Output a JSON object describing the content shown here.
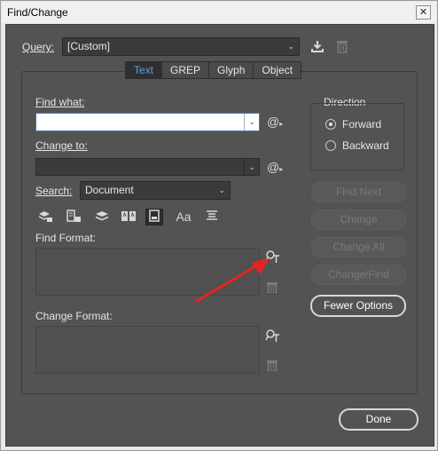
{
  "window": {
    "title": "Find/Change",
    "close_glyph": "✕"
  },
  "query": {
    "label": "Query:",
    "value": "[Custom]",
    "save_icon": "save-query-icon",
    "delete_icon": "delete-query-icon"
  },
  "tabs": [
    {
      "label": "Text",
      "active": true
    },
    {
      "label": "GREP",
      "active": false
    },
    {
      "label": "Glyph",
      "active": false
    },
    {
      "label": "Object",
      "active": false
    }
  ],
  "find": {
    "label": "Find what:",
    "value": "",
    "special_chars_glyph": "@"
  },
  "change": {
    "label": "Change to:",
    "value": "",
    "special_chars_glyph": "@"
  },
  "search": {
    "label": "Search:",
    "value": "Document"
  },
  "options_icons": [
    "include-locked-layers-icon",
    "include-locked-stories-icon",
    "include-hidden-layers-icon",
    "include-master-pages-icon",
    "include-footnotes-icon",
    "case-sensitive-icon",
    "whole-word-icon"
  ],
  "case_sensitive_glyph": "Aa",
  "find_format": {
    "label": "Find Format:"
  },
  "change_format": {
    "label": "Change Format:"
  },
  "direction": {
    "label": "Direction",
    "options": [
      {
        "label": "Forward",
        "checked": true
      },
      {
        "label": "Backward",
        "checked": false
      }
    ]
  },
  "buttons": {
    "find_next": "Find Next",
    "change": "Change",
    "change_all": "Change All",
    "change_find": "Change/Find",
    "fewer_options": "Fewer Options",
    "done": "Done"
  },
  "colors": {
    "dialog_bg": "#535353",
    "active_tab_text": "#5aa0e6",
    "annotation_arrow": "#e8231f"
  }
}
